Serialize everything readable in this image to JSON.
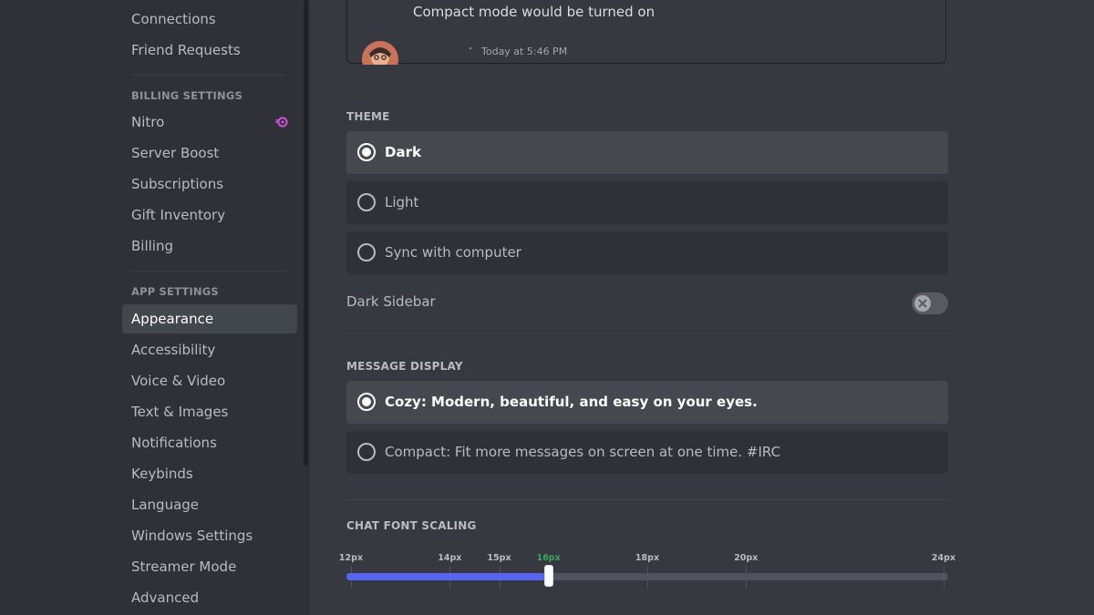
{
  "sidebar": {
    "items_top": [
      {
        "label": "Connections"
      },
      {
        "label": "Friend Requests"
      }
    ],
    "billing_header": "BILLING SETTINGS",
    "billing_items": [
      {
        "label": "Nitro"
      },
      {
        "label": "Server Boost"
      },
      {
        "label": "Subscriptions"
      },
      {
        "label": "Gift Inventory"
      },
      {
        "label": "Billing"
      }
    ],
    "app_header": "APP SETTINGS",
    "app_items": [
      {
        "label": "Appearance",
        "selected": true
      },
      {
        "label": "Accessibility"
      },
      {
        "label": "Voice & Video"
      },
      {
        "label": "Text & Images"
      },
      {
        "label": "Notifications"
      },
      {
        "label": "Keybinds"
      },
      {
        "label": "Language"
      },
      {
        "label": "Windows Settings"
      },
      {
        "label": "Streamer Mode"
      },
      {
        "label": "Advanced"
      }
    ],
    "nitro_badge_icon": "nitro-icon",
    "nitro_badge_color": "#d14ed7"
  },
  "preview": {
    "message": "Compact mode would be turned on",
    "timestamp": "Today at 5:46 PM"
  },
  "theme": {
    "header": "THEME",
    "options": [
      {
        "label": "Dark",
        "selected": true
      },
      {
        "label": "Light",
        "selected": false
      },
      {
        "label": "Sync with computer",
        "selected": false
      }
    ]
  },
  "dark_sidebar": {
    "label": "Dark Sidebar",
    "enabled": false,
    "icon": "close-icon"
  },
  "message_display": {
    "header": "MESSAGE DISPLAY",
    "options": [
      {
        "label": "Cozy: Modern, beautiful, and easy on your eyes.",
        "selected": true
      },
      {
        "label": "Compact: Fit more messages on screen at one time. #IRC",
        "selected": false
      }
    ]
  },
  "font_scaling": {
    "header": "CHAT FONT SCALING",
    "min": 12,
    "max": 24,
    "value": 16,
    "ticks": [
      "12px",
      "14px",
      "15px",
      "16px",
      "18px",
      "20px",
      "24px"
    ],
    "tick_values": [
      12,
      14,
      15,
      16,
      18,
      20,
      24
    ],
    "active_tick_color": "#3ba55d",
    "fill_color": "#5865f2"
  }
}
